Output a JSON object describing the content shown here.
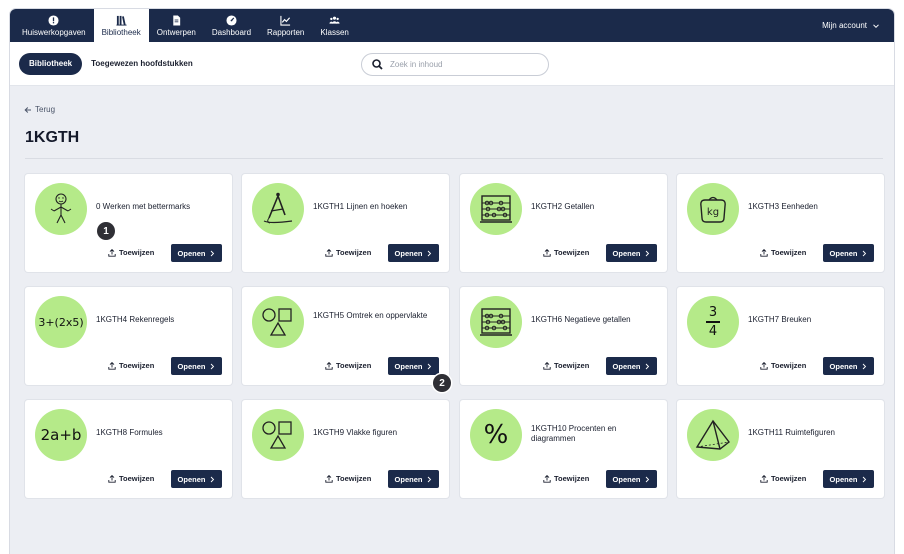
{
  "nav": {
    "items": [
      {
        "label": "Huiswerkopgaven",
        "icon": "alert-circle-icon"
      },
      {
        "label": "Bibliotheek",
        "icon": "library-icon",
        "active": true
      },
      {
        "label": "Ontwerpen",
        "icon": "document-icon"
      },
      {
        "label": "Dashboard",
        "icon": "gauge-icon"
      },
      {
        "label": "Rapporten",
        "icon": "chart-icon"
      },
      {
        "label": "Klassen",
        "icon": "users-icon"
      }
    ],
    "account": "Mijn account"
  },
  "subbar": {
    "active_tab": "Bibliotheek",
    "tab2": "Toegewezen hoofdstukken",
    "search_placeholder": "Zoek in inhoud"
  },
  "page": {
    "back": "Terug",
    "title": "1KGTH"
  },
  "card_actions": {
    "assign": "Toewijzen",
    "open": "Openen"
  },
  "cards": [
    {
      "title": "0 Werken met bettermarks",
      "image": "stick-figure-icon"
    },
    {
      "title": "1KGTH1 Lijnen en hoeken",
      "image": "compass-icon"
    },
    {
      "title": "1KGTH2 Getallen",
      "image": "abacus-icon"
    },
    {
      "title": "1KGTH3 Eenheden",
      "image": "weight-kg-icon",
      "image_text": "kg"
    },
    {
      "title": "1KGTH4 Rekenregels",
      "image": "formula-image",
      "image_text": "3+(2x5)"
    },
    {
      "title": "1KGTH5 Omtrek en oppervlakte",
      "image": "shapes-icon"
    },
    {
      "title": "1KGTH6 Negatieve getallen",
      "image": "abacus-icon"
    },
    {
      "title": "1KGTH7 Breuken",
      "image": "fraction-image",
      "image_text_num": "3",
      "image_text_den": "4"
    },
    {
      "title": "1KGTH8 Formules",
      "image": "formula-image",
      "image_text": "2a+b"
    },
    {
      "title": "1KGTH9 Vlakke figuren",
      "image": "shapes-icon"
    },
    {
      "title": "1KGTH10 Procenten en diagrammen",
      "image": "percent-image",
      "image_text": "%"
    },
    {
      "title": "1KGTH11 Ruimtefiguren",
      "image": "pyramid-icon"
    }
  ],
  "badges": [
    "1",
    "2"
  ],
  "colors": {
    "navy": "#1b2a4a",
    "card_circle": "#b5ea89",
    "background": "#eceef3"
  }
}
